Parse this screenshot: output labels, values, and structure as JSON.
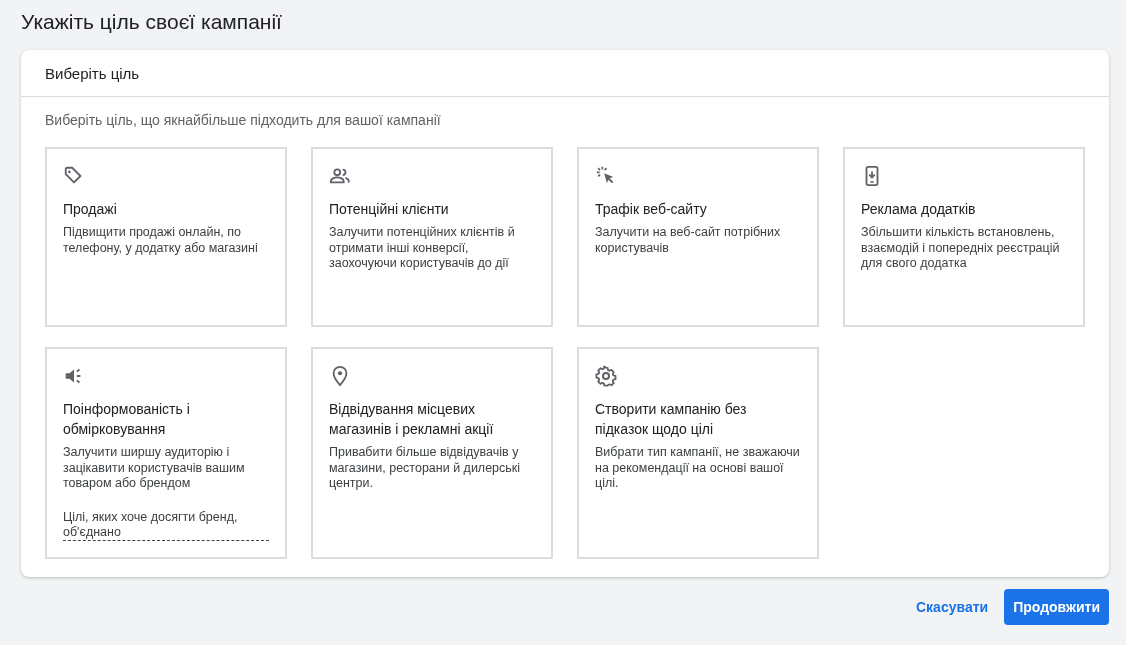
{
  "page_title": "Укажіть ціль своєї кампанії",
  "panel": {
    "title": "Виберіть ціль",
    "subtitle": "Виберіть ціль, що якнайбільше підходить для вашої кампанії",
    "goals": [
      {
        "kind": "tag",
        "title": "Продажі",
        "description": "Підвищити продажі онлайн, по телефону, у додатку або магазині"
      },
      {
        "kind": "people",
        "title": "Потенційні клієнти",
        "description": "Залучити потенційних клієнтів й отримати інші конверсії, заохочуючи користувачів до дії"
      },
      {
        "kind": "click",
        "title": "Трафік веб-сайту",
        "description": "Залучити на веб-сайт потрібних користувачів"
      },
      {
        "kind": "phone",
        "title": "Реклама додатків",
        "description": "Збільшити кількість встановлень, взаємодій і попередніх реєстрацій для свого додатка"
      },
      {
        "kind": "speaker",
        "title": "Поінформованість і обмірковування",
        "description": "Залучити ширшу аудиторію і зацікавити користувачів вашим товаром або брендом",
        "note": "Цілі, яких хоче досягти бренд, об'єднано"
      },
      {
        "kind": "pin",
        "title": "Відвідування місцевих магазинів і рекламні акції",
        "description": "Привабити більше відвідувачів у магазини, ресторани й дилерські центри."
      },
      {
        "kind": "gear",
        "title": "Створити кампанію без підказок щодо цілі",
        "description": "Вибрати тип кампанії, не зважаючи на рекомендації на основі вашої цілі."
      }
    ]
  },
  "actions": {
    "cancel": "Скасувати",
    "continue": "Продовжити"
  }
}
